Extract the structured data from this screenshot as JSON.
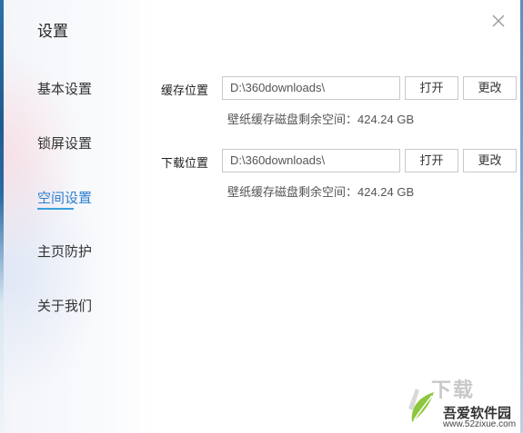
{
  "sidebar": {
    "title": "设置",
    "items": [
      {
        "label": "基本设置"
      },
      {
        "label": "锁屏设置"
      },
      {
        "label": "空间设置",
        "active": true
      },
      {
        "label": "主页防护"
      },
      {
        "label": "关于我们"
      }
    ]
  },
  "cache": {
    "label": "缓存位置",
    "path": "D:\\360downloads\\",
    "open_label": "打开",
    "change_label": "更改",
    "space_info": "壁纸缓存磁盘剩余空间：424.24 GB"
  },
  "download": {
    "label": "下载位置",
    "path": "D:\\360downloads\\",
    "open_label": "打开",
    "change_label": "更改",
    "space_info": "壁纸缓存磁盘剩余空间：424.24 GB"
  },
  "watermark": {
    "big_text": "下载",
    "brand": "吾爱软件园",
    "url": "www.52zixue.com"
  },
  "colors": {
    "accent": "#2f7fd0",
    "underline": "#3aa0dc"
  }
}
